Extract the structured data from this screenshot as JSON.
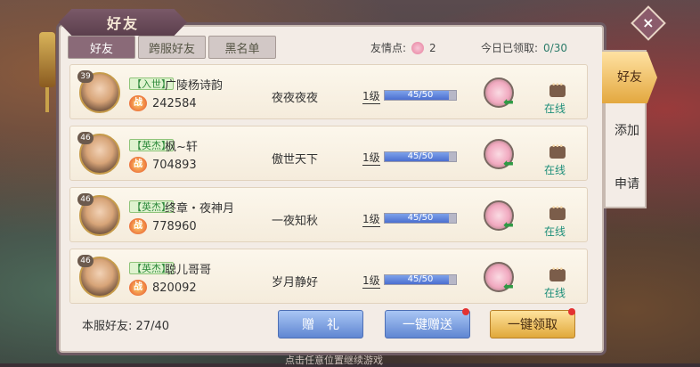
{
  "window": {
    "title": "好友",
    "close_icon": "×"
  },
  "tabs": [
    {
      "label": "好友",
      "active": true
    },
    {
      "label": "跨服好友",
      "active": false
    },
    {
      "label": "黑名单",
      "active": false
    }
  ],
  "stats": {
    "friendship_label": "友情点:",
    "friendship_value": "2",
    "claimed_label": "今日已领取:",
    "claimed_value": "0/30"
  },
  "friends": [
    {
      "level": "39",
      "tag": "【入世】",
      "name": "广陵杨诗韵",
      "power_icon": "战",
      "power": "242584",
      "guild": "夜夜夜夜",
      "friend_level": "1级",
      "progress": "45/50",
      "progress_fraction": 0.9,
      "status": "在线"
    },
    {
      "level": "46",
      "tag": "【英杰】",
      "name": "枫~轩",
      "power_icon": "战",
      "power": "704893",
      "guild": "傲世天下",
      "friend_level": "1级",
      "progress": "45/50",
      "progress_fraction": 0.9,
      "status": "在线"
    },
    {
      "level": "46",
      "tag": "【英杰】",
      "name": "终章・夜神月",
      "power_icon": "战",
      "power": "778960",
      "guild": "一夜知秋",
      "friend_level": "1级",
      "progress": "45/50",
      "progress_fraction": 0.9,
      "status": "在线"
    },
    {
      "level": "46",
      "tag": "【英杰】",
      "name": "聪儿哥哥",
      "power_icon": "战",
      "power": "820092",
      "guild": "岁月静好",
      "friend_level": "1级",
      "progress": "45/50",
      "progress_fraction": 0.9,
      "status": "在线"
    }
  ],
  "footer": {
    "count_label": "本服好友:",
    "count_value": "27/40",
    "gift_button": "赠　礼",
    "send_all_button": "一键赠送",
    "claim_all_button": "一键领取"
  },
  "side_tabs": [
    {
      "label": "好友",
      "active": true
    },
    {
      "label": "添加",
      "active": false
    },
    {
      "label": "申请",
      "active": false
    }
  ],
  "hint": "点击任意位置继续游戏"
}
